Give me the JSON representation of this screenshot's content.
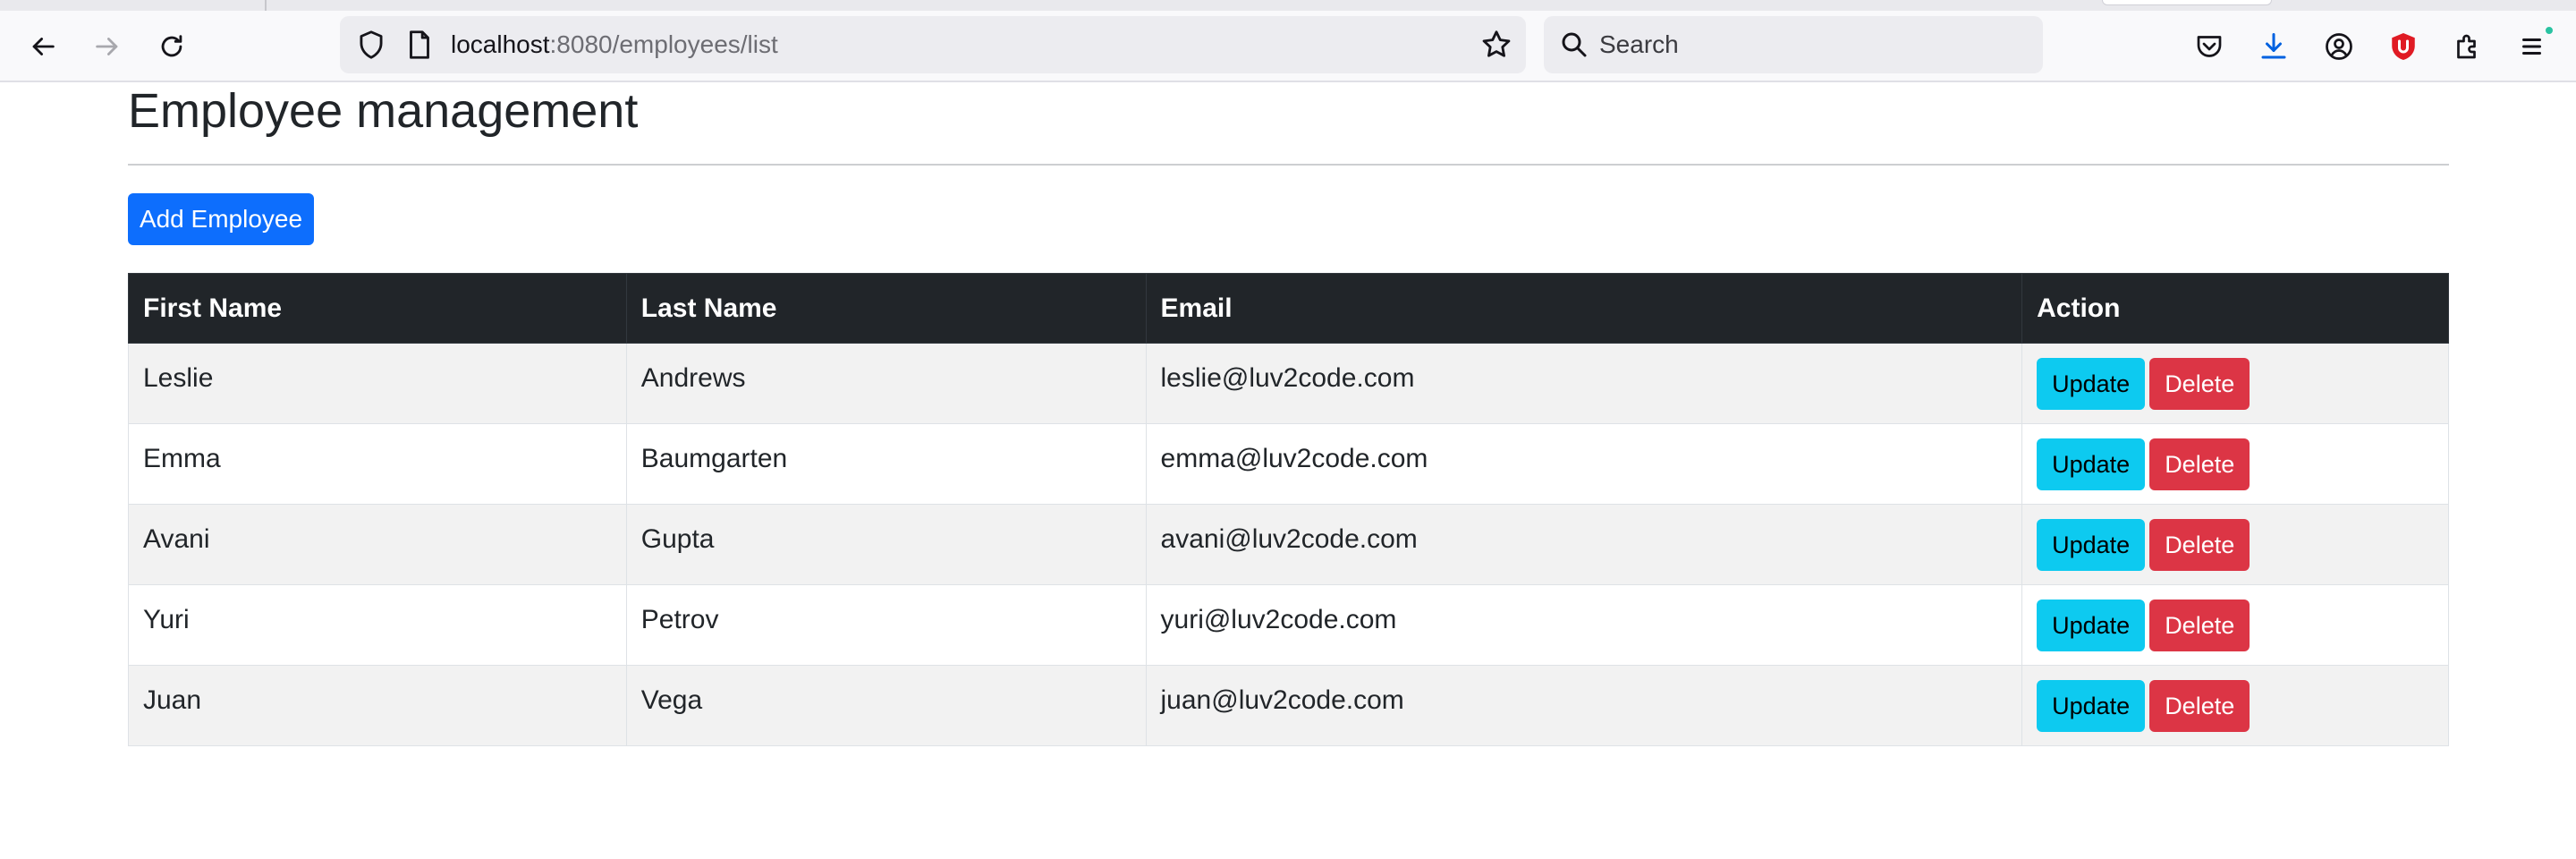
{
  "browser": {
    "url_host": "localhost",
    "url_path": ":8080/employees/list",
    "search_placeholder": "Search",
    "icons": [
      "back-icon",
      "forward-icon",
      "reload-icon",
      "shield-icon",
      "page-icon",
      "bookmark-star-icon",
      "search-icon",
      "pocket-icon",
      "download-icon",
      "account-icon",
      "ublock-icon",
      "extensions-icon",
      "menu-icon"
    ],
    "accent_download": "#0061e0",
    "accent_ublock": "#e01b24"
  },
  "page": {
    "title": "Employee management",
    "add_button_label": "Add Employee"
  },
  "table": {
    "columns": [
      "First Name",
      "Last Name",
      "Email",
      "Action"
    ],
    "update_label": "Update",
    "delete_label": "Delete",
    "rows": [
      {
        "first_name": "Leslie",
        "last_name": "Andrews",
        "email": "leslie@luv2code.com"
      },
      {
        "first_name": "Emma",
        "last_name": "Baumgarten",
        "email": "emma@luv2code.com"
      },
      {
        "first_name": "Avani",
        "last_name": "Gupta",
        "email": "avani@luv2code.com"
      },
      {
        "first_name": "Yuri",
        "last_name": "Petrov",
        "email": "yuri@luv2code.com"
      },
      {
        "first_name": "Juan",
        "last_name": "Vega",
        "email": "juan@luv2code.com"
      }
    ]
  },
  "colors": {
    "primary": "#0d6efd",
    "info": "#0dcaf0",
    "danger": "#dc3545",
    "table_header": "#212529",
    "stripe": "#f2f2f2"
  }
}
